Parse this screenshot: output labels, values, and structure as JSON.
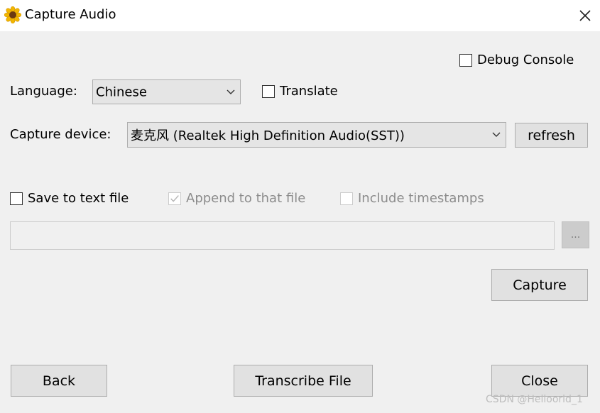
{
  "window": {
    "title": "Capture Audio",
    "app_icon": "sunflower-icon",
    "close_icon": "close-icon"
  },
  "debug_console": {
    "label": "Debug Console",
    "checked": false
  },
  "language": {
    "label": "Language:",
    "selected": "Chinese",
    "translate_label": "Translate",
    "translate_checked": false
  },
  "capture_device": {
    "label": "Capture device:",
    "selected": "麦克风 (Realtek High Definition Audio(SST))",
    "refresh_label": "refresh"
  },
  "save": {
    "save_label": "Save to text file",
    "save_checked": false,
    "append_label": "Append to that file",
    "append_checked": true,
    "timestamps_label": "Include timestamps",
    "timestamps_checked": false,
    "file_path": "",
    "browse_label": "..."
  },
  "buttons": {
    "capture": "Capture",
    "back": "Back",
    "transcribe": "Transcribe File",
    "close": "Close"
  },
  "watermark": "CSDN @Helloorld_1",
  "colors": {
    "window_bg": "#f0f0f0",
    "titlebar_bg": "#ffffff",
    "button_bg": "#e1e1e1",
    "disabled_text": "#8c8c8c"
  }
}
